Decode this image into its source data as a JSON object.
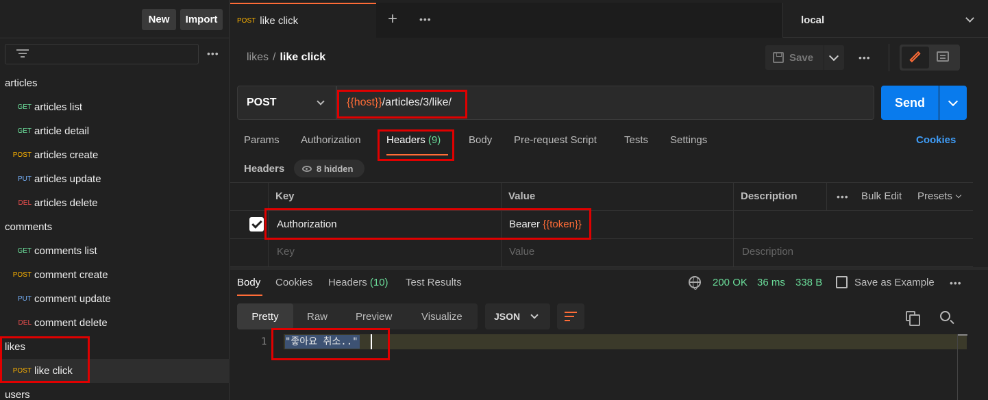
{
  "sidebar": {
    "new_label": "New",
    "import_label": "Import",
    "more_label": "•••",
    "items": [
      {
        "kind": "folder",
        "name": "articles"
      },
      {
        "kind": "request",
        "method": "GET",
        "name": "articles list"
      },
      {
        "kind": "request",
        "method": "GET",
        "name": "article detail"
      },
      {
        "kind": "request",
        "method": "POST",
        "name": "articles create"
      },
      {
        "kind": "request",
        "method": "PUT",
        "name": "articles update"
      },
      {
        "kind": "request",
        "method": "DEL",
        "name": "articles delete"
      },
      {
        "kind": "folder",
        "name": "comments"
      },
      {
        "kind": "request",
        "method": "GET",
        "name": "comments list"
      },
      {
        "kind": "request",
        "method": "POST",
        "name": "comment create"
      },
      {
        "kind": "request",
        "method": "PUT",
        "name": "comment update"
      },
      {
        "kind": "request",
        "method": "DEL",
        "name": "comment delete"
      },
      {
        "kind": "folder",
        "name": "likes"
      },
      {
        "kind": "request",
        "method": "POST",
        "name": "like click",
        "selected": true
      },
      {
        "kind": "folder",
        "name": "users"
      }
    ]
  },
  "tabbar": {
    "active_tab_method": "POST",
    "active_tab_name": "like click",
    "plus_label": "+",
    "more_label": "•••",
    "environment": "local"
  },
  "breadcrumb": {
    "parent": "likes",
    "separator": "/",
    "current": "like click"
  },
  "toolbar": {
    "save_label": "Save",
    "more_label": "•••"
  },
  "request": {
    "method": "POST",
    "url_var": "{{host}}",
    "url_path": "/articles/3/like/",
    "send_label": "Send"
  },
  "request_tabs": {
    "params": "Params",
    "authorization": "Authorization",
    "headers": "Headers",
    "headers_count": "(9)",
    "body": "Body",
    "prerequest": "Pre-request Script",
    "tests": "Tests",
    "settings": "Settings",
    "cookies": "Cookies"
  },
  "headers_section": {
    "label": "Headers",
    "hidden_badge": "8 hidden",
    "columns": {
      "key": "Key",
      "value": "Value",
      "description": "Description"
    },
    "more_label": "•••",
    "bulk_edit": "Bulk Edit",
    "presets": "Presets",
    "rows": [
      {
        "checked": true,
        "key": "Authorization",
        "value_prefix": "Bearer ",
        "value_var": "{{token}}",
        "description": ""
      }
    ],
    "placeholders": {
      "key": "Key",
      "value": "Value",
      "description": "Description"
    }
  },
  "response": {
    "tabs": {
      "body": "Body",
      "cookies": "Cookies",
      "headers": "Headers",
      "headers_count": "(10)",
      "test_results": "Test Results"
    },
    "status": "200 OK",
    "time": "36 ms",
    "size": "338 B",
    "save_example": "Save as Example",
    "more_label": "•••",
    "format_tabs": [
      "Pretty",
      "Raw",
      "Preview",
      "Visualize"
    ],
    "active_format": "Pretty",
    "language": "JSON",
    "line_number": "1",
    "body_text": "\"좋아요 취소..\""
  },
  "colors": {
    "accent": "#ff6c37",
    "send_blue": "#097bed",
    "status_green": "#6bdd9a",
    "annotation_red": "#e00000"
  }
}
